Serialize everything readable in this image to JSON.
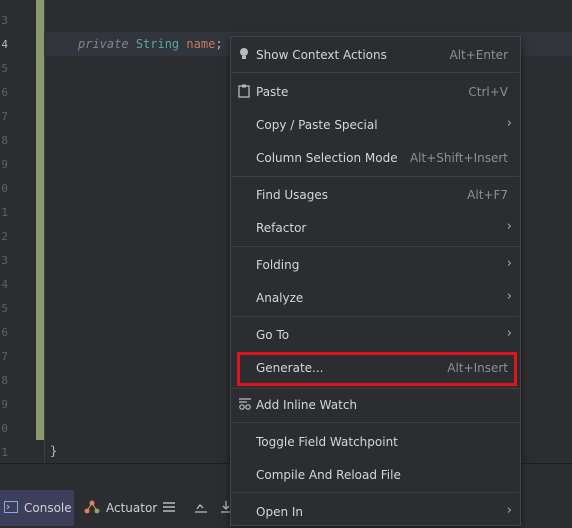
{
  "editor": {
    "line_numbers": [
      "3",
      "4",
      "5",
      "6",
      "7",
      "8",
      "9",
      "0",
      "1",
      "2",
      "3",
      "4",
      "5",
      "6",
      "7",
      "8",
      "9",
      "0",
      "1"
    ],
    "active_line_index": 1,
    "code_line": {
      "keyword": "private",
      "type": "String",
      "name": "name",
      "punct": ";"
    },
    "closing_brace": "}"
  },
  "context_menu": {
    "items": [
      {
        "label": "Show Context Actions",
        "shortcut": "Alt+Enter",
        "icon": "lightbulb-icon"
      },
      {
        "label": "Paste",
        "shortcut": "Ctrl+V",
        "icon": "clipboard-icon"
      },
      {
        "label": "Copy / Paste Special",
        "submenu": true
      },
      {
        "label": "Column Selection Mode",
        "shortcut": "Alt+Shift+Insert"
      },
      {
        "label": "Find Usages",
        "shortcut": "Alt+F7"
      },
      {
        "label": "Refactor",
        "submenu": true
      },
      {
        "label": "Folding",
        "submenu": true
      },
      {
        "label": "Analyze",
        "submenu": true
      },
      {
        "label": "Go To",
        "submenu": true
      },
      {
        "label": "Generate...",
        "shortcut": "Alt+Insert",
        "highlighted": true
      },
      {
        "label": "Add Inline Watch",
        "icon": "inline-watch-icon"
      },
      {
        "label": "Toggle Field Watchpoint"
      },
      {
        "label": "Compile And Reload File"
      },
      {
        "label": "Open In",
        "submenu": true
      }
    ],
    "submenu_arrow": "›",
    "highlight_color": "#e0141c"
  },
  "bottom_toolbar": {
    "console_label": "Console",
    "actuator_label": "Actuator"
  }
}
